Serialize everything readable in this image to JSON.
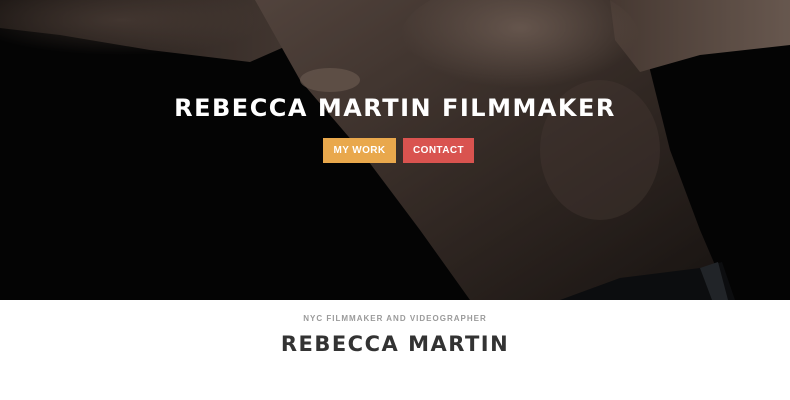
{
  "hero": {
    "title": "REBECCA MARTIN FILMMAKER",
    "buttons": {
      "work_label": "MY WORK",
      "contact_label": "CONTACT"
    },
    "image": "shirtless-man-back-arms-outstretched-photo"
  },
  "intro": {
    "subtitle": "NYC FILMMAKER AND VIDEOGRAPHER",
    "name": "REBECCA MARTIN"
  },
  "colors": {
    "work_button": "#e9a84c",
    "contact_button": "#d9534f",
    "hero_background": "#060606",
    "heading_text": "#333333",
    "subtitle_text": "#9a9a9a"
  }
}
